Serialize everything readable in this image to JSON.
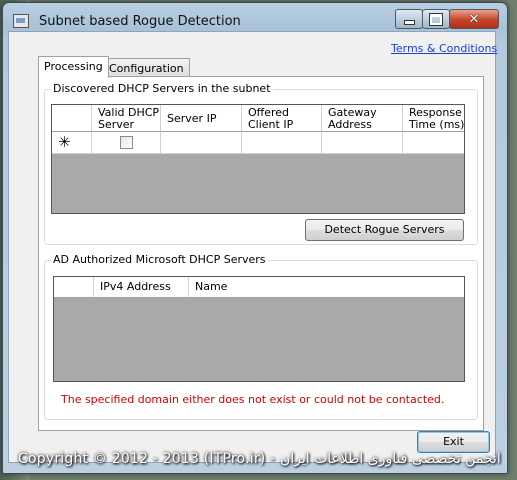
{
  "window": {
    "title": "Subnet based Rogue Detection",
    "controls": {
      "minimize": "minimize",
      "maximize": "maximize",
      "close": "close"
    }
  },
  "terms_link": "Terms & Conditions",
  "tabs": [
    {
      "label": "Processing",
      "active": true
    },
    {
      "label": "Configuration",
      "active": false
    }
  ],
  "discovered": {
    "group_label": "Discovered DHCP Servers in the subnet",
    "columns": [
      "Valid DHCP Server",
      "Server IP",
      "Offered Client IP",
      "Gateway Address",
      "Response Time (ms)"
    ],
    "new_row_marker": "✳",
    "detect_button": "Detect Rogue Servers"
  },
  "ad_authorized": {
    "group_label": "AD Authorized Microsoft DHCP Servers",
    "columns": [
      "IPv4 Address",
      "Name"
    ]
  },
  "error_message": "The specified domain either does not exist or could not be contacted.",
  "exit_button": "Exit",
  "watermark": "Copyright © 2012 - 2013 (ITPro.ir) - انجمن تخصصی فناوری اطلاعات ایران",
  "colors": {
    "error": "#d40000",
    "link": "#1a3fd4",
    "grid_empty": "#a9a9a9"
  }
}
